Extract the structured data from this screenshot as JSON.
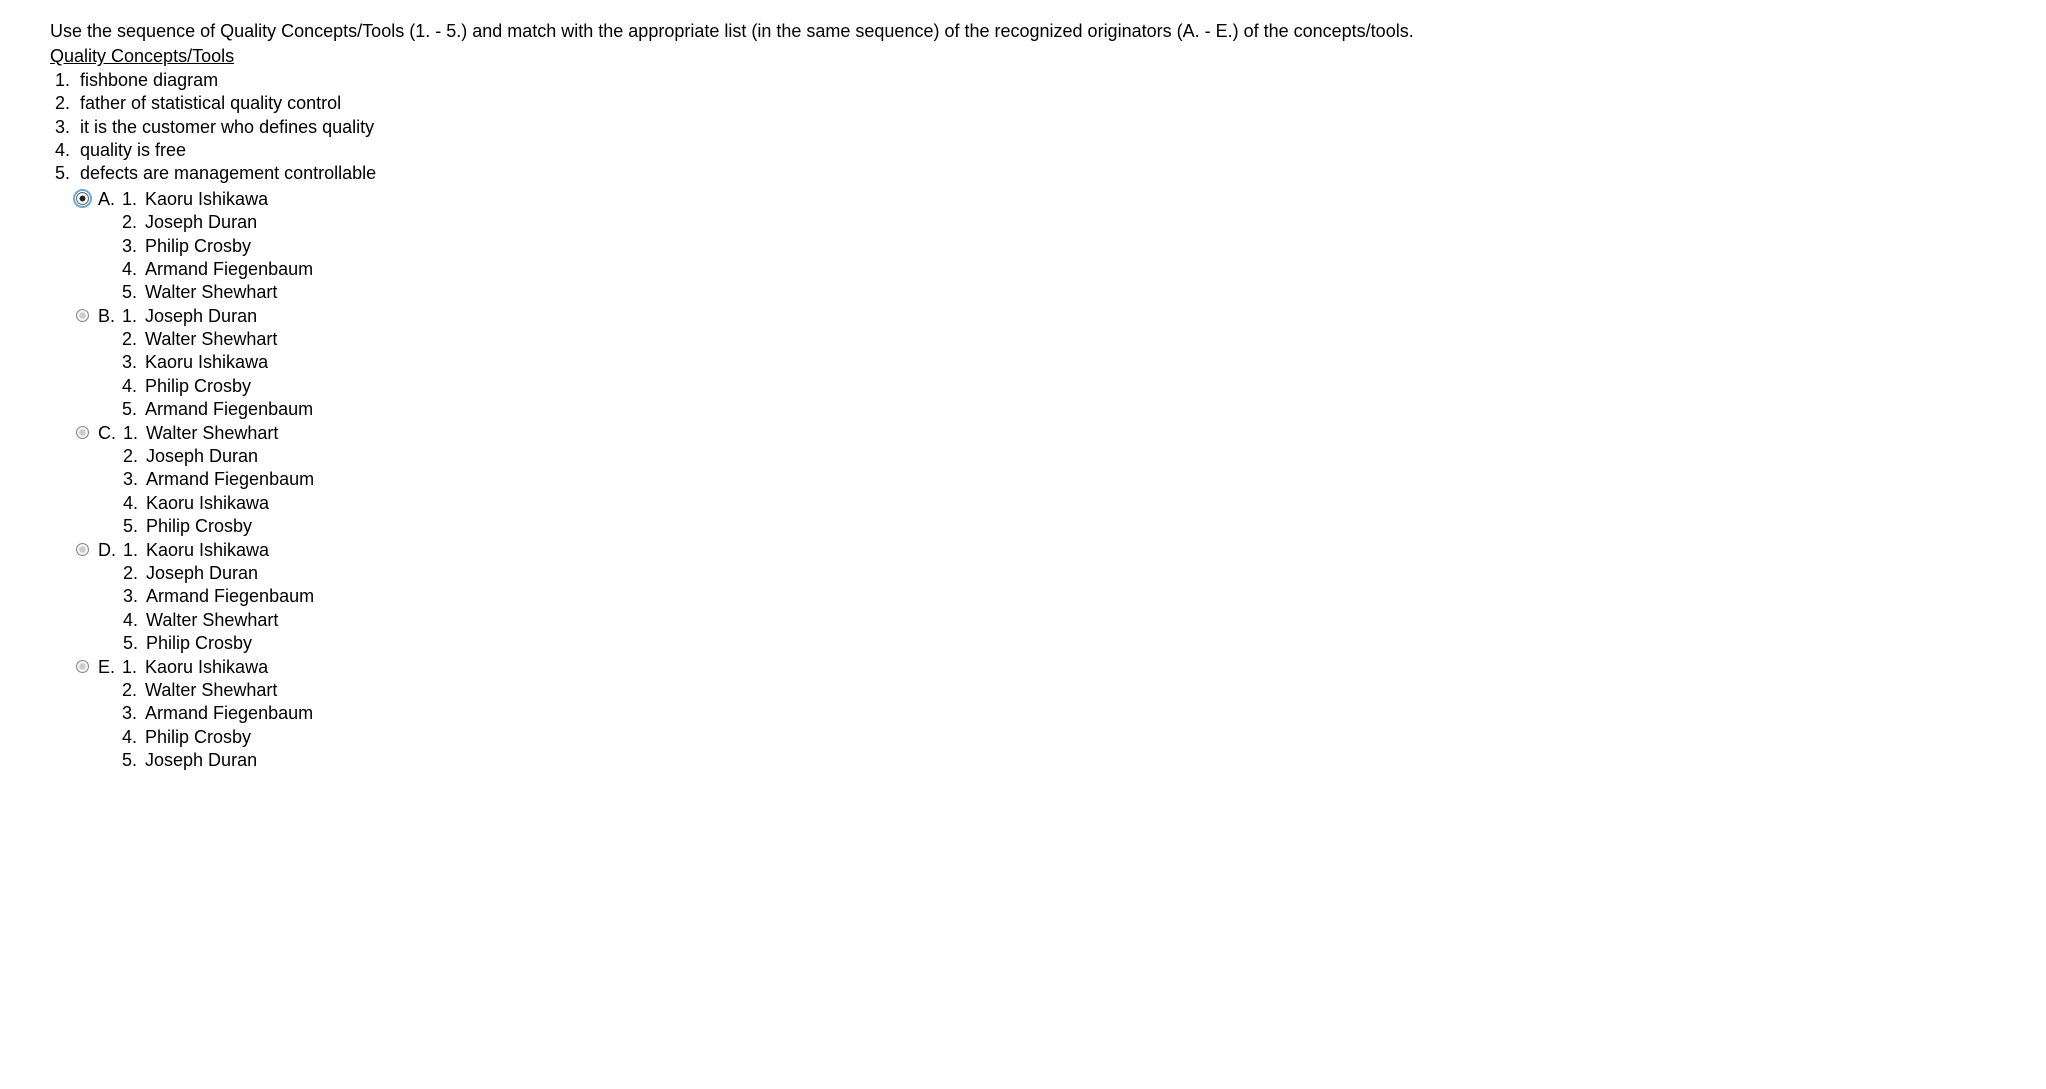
{
  "question": {
    "intro": "Use the sequence of Quality Concepts/Tools (1. - 5.) and match with the appropriate list (in the same sequence) of the recognized originators (A. - E.) of the concepts/tools.",
    "heading": "Quality Concepts/Tools",
    "concepts": [
      {
        "num": "1.",
        "text": "fishbone diagram"
      },
      {
        "num": "2.",
        "text": "father of statistical quality control"
      },
      {
        "num": "3.",
        "text": "it is the customer who defines quality"
      },
      {
        "num": "4.",
        "text": "quality is free"
      },
      {
        "num": "5.",
        "text": "defects are management controllable"
      }
    ]
  },
  "options": [
    {
      "letter": "A.",
      "selected": true,
      "items": [
        {
          "num": "1.",
          "text": "Kaoru Ishikawa"
        },
        {
          "num": "2.",
          "text": "Joseph Duran"
        },
        {
          "num": "3.",
          "text": "Philip Crosby"
        },
        {
          "num": "4.",
          "text": "Armand Fiegenbaum"
        },
        {
          "num": "5.",
          "text": "Walter Shewhart"
        }
      ]
    },
    {
      "letter": "B.",
      "selected": false,
      "items": [
        {
          "num": "1.",
          "text": "Joseph Duran"
        },
        {
          "num": "2.",
          "text": "Walter Shewhart"
        },
        {
          "num": "3.",
          "text": "Kaoru Ishikawa"
        },
        {
          "num": "4.",
          "text": "Philip Crosby"
        },
        {
          "num": "5.",
          "text": "Armand Fiegenbaum"
        }
      ]
    },
    {
      "letter": "C.",
      "selected": false,
      "items": [
        {
          "num": "1.",
          "text": "Walter Shewhart"
        },
        {
          "num": "2.",
          "text": "Joseph Duran"
        },
        {
          "num": "3.",
          "text": "Armand Fiegenbaum"
        },
        {
          "num": "4.",
          "text": "Kaoru Ishikawa"
        },
        {
          "num": "5.",
          "text": "Philip Crosby"
        }
      ]
    },
    {
      "letter": "D.",
      "selected": false,
      "items": [
        {
          "num": "1.",
          "text": "Kaoru Ishikawa"
        },
        {
          "num": "2.",
          "text": "Joseph Duran"
        },
        {
          "num": "3.",
          "text": "Armand Fiegenbaum"
        },
        {
          "num": "4.",
          "text": "Walter Shewhart"
        },
        {
          "num": "5.",
          "text": "Philip Crosby"
        }
      ]
    },
    {
      "letter": "E.",
      "selected": false,
      "items": [
        {
          "num": "1.",
          "text": "Kaoru Ishikawa"
        },
        {
          "num": "2.",
          "text": "Walter Shewhart"
        },
        {
          "num": "3.",
          "text": "Armand Fiegenbaum"
        },
        {
          "num": "4.",
          "text": "Philip Crosby"
        },
        {
          "num": "5.",
          "text": "Joseph Duran"
        }
      ]
    }
  ]
}
